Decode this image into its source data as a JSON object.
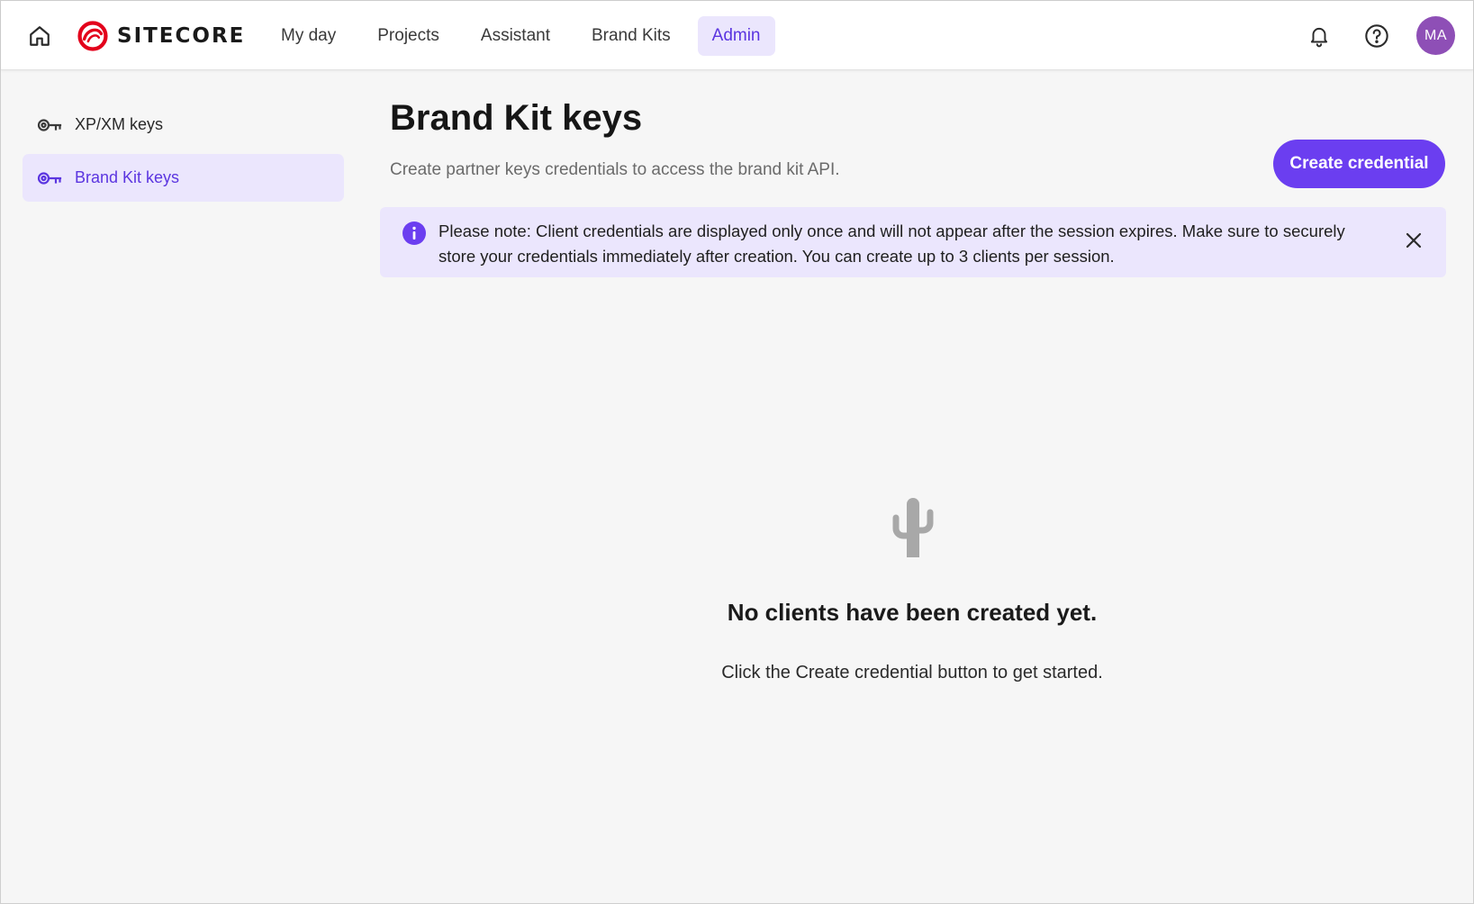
{
  "header": {
    "logo_text": "SITECORE",
    "nav": [
      {
        "label": "My day",
        "active": false
      },
      {
        "label": "Projects",
        "active": false
      },
      {
        "label": "Assistant",
        "active": false
      },
      {
        "label": "Brand Kits",
        "active": false
      },
      {
        "label": "Admin",
        "active": true
      }
    ],
    "icons": [
      "home-icon",
      "bell-icon",
      "help-icon"
    ],
    "avatar_initials": "MA",
    "avatar_color": "#8e4fb6"
  },
  "sidebar": {
    "items": [
      {
        "label": "XP/XM keys",
        "icon": "key-icon",
        "active": false
      },
      {
        "label": "Brand Kit keys",
        "icon": "key-icon",
        "active": true
      }
    ]
  },
  "main": {
    "title": "Brand Kit keys",
    "subtitle": "Create partner keys credentials to access the brand kit API.",
    "create_button": "Create credential",
    "notice": "Please note: Client credentials are displayed only once and will not appear after the session expires. Make sure to securely store your credentials immediately after creation. You can create up to 3 clients per session.",
    "empty_state": {
      "icon": "cactus-icon",
      "title": "No clients have been created yet.",
      "description": "Click the Create credential button to get started."
    }
  },
  "colors": {
    "accent": "#6b3ef0",
    "accent_light": "#ebe6fd",
    "brand_red": "#e3001b"
  }
}
